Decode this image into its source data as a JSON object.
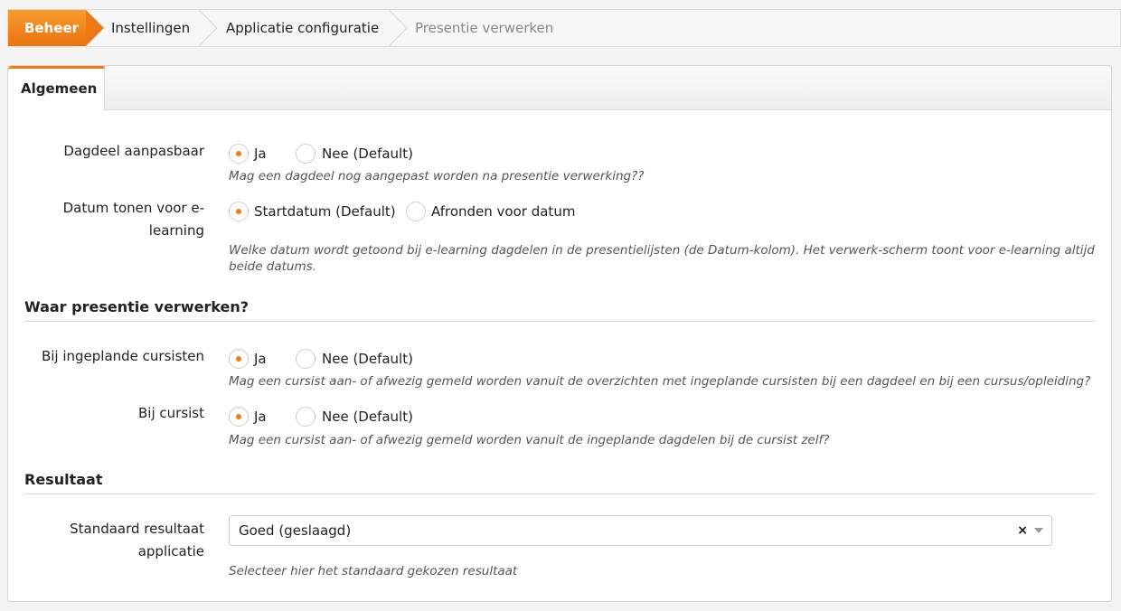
{
  "breadcrumb": {
    "items": [
      "Beheer",
      "Instellingen",
      "Applicatie configuratie",
      "Presentie verwerken"
    ]
  },
  "tabs": {
    "active": "Algemeen"
  },
  "fields": {
    "dagdeel": {
      "label": "Dagdeel aanpasbaar",
      "options": [
        "Ja",
        "Nee (Default)"
      ],
      "selected": "Ja",
      "help": "Mag een dagdeel nog aangepast worden na presentie verwerking??"
    },
    "datum": {
      "label": "Datum tonen voor e-learning",
      "options": [
        "Startdatum (Default)",
        "Afronden voor datum"
      ],
      "selected": "Startdatum (Default)",
      "help": "Welke datum wordt getoond bij e-learning dagdelen in de presentielijsten (de Datum-kolom). Het verwerk-scherm toont voor e-learning altijd beide datums."
    },
    "ingeplande": {
      "label": "Bij ingeplande cursisten",
      "options": [
        "Ja",
        "Nee (Default)"
      ],
      "selected": "Ja",
      "help": "Mag een cursist aan- of afwezig gemeld worden vanuit de overzichten met ingeplande cursisten bij een dagdeel en bij een cursus/opleiding?"
    },
    "cursist": {
      "label": "Bij cursist",
      "options": [
        "Ja",
        "Nee (Default)"
      ],
      "selected": "Ja",
      "help": "Mag een cursist aan- of afwezig gemeld worden vanuit de ingeplande dagdelen bij de cursist zelf?"
    },
    "resultaat": {
      "label": "Standaard resultaat applicatie",
      "value": "Goed (geslaagd)",
      "help": "Selecteer hier het standaard gekozen resultaat"
    }
  },
  "sections": {
    "waar": "Waar presentie verwerken?",
    "resultaat": "Resultaat"
  },
  "icons": {
    "clear": "×",
    "dropdown": "chevron-down-icon"
  },
  "colors": {
    "accent": "#f07f12"
  }
}
